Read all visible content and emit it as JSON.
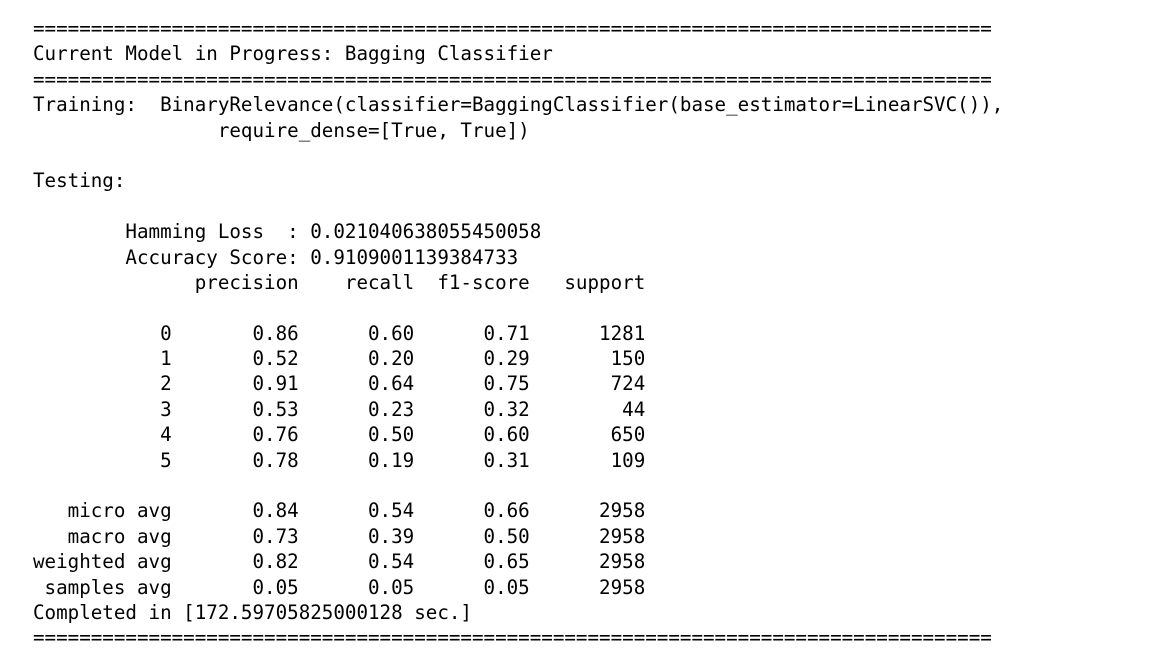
{
  "console": {
    "lines": [
      "===================================================================================",
      "Current Model in Progress: Bagging Classifier",
      "===================================================================================",
      "Training:  BinaryRelevance(classifier=BaggingClassifier(base_estimator=LinearSVC()),",
      "                require_dense=[True, True])",
      "",
      "Testing:",
      "",
      "        Hamming Loss  : 0.021040638055450058",
      "        Accuracy Score: 0.9109001139384733",
      "              precision    recall  f1-score   support",
      "",
      "           0       0.86      0.60      0.71      1281",
      "           1       0.52      0.20      0.29       150",
      "           2       0.91      0.64      0.75       724",
      "           3       0.53      0.23      0.32        44",
      "           4       0.76      0.50      0.60       650",
      "           5       0.78      0.19      0.31       109",
      "",
      "   micro avg       0.84      0.54      0.66      2958",
      "   macro avg       0.73      0.39      0.50      2958",
      "weighted avg       0.82      0.54      0.65      2958",
      " samples avg       0.05      0.05      0.05      2958",
      "Completed in [172.59705825000128 sec.]",
      "==================================================================================="
    ]
  }
}
